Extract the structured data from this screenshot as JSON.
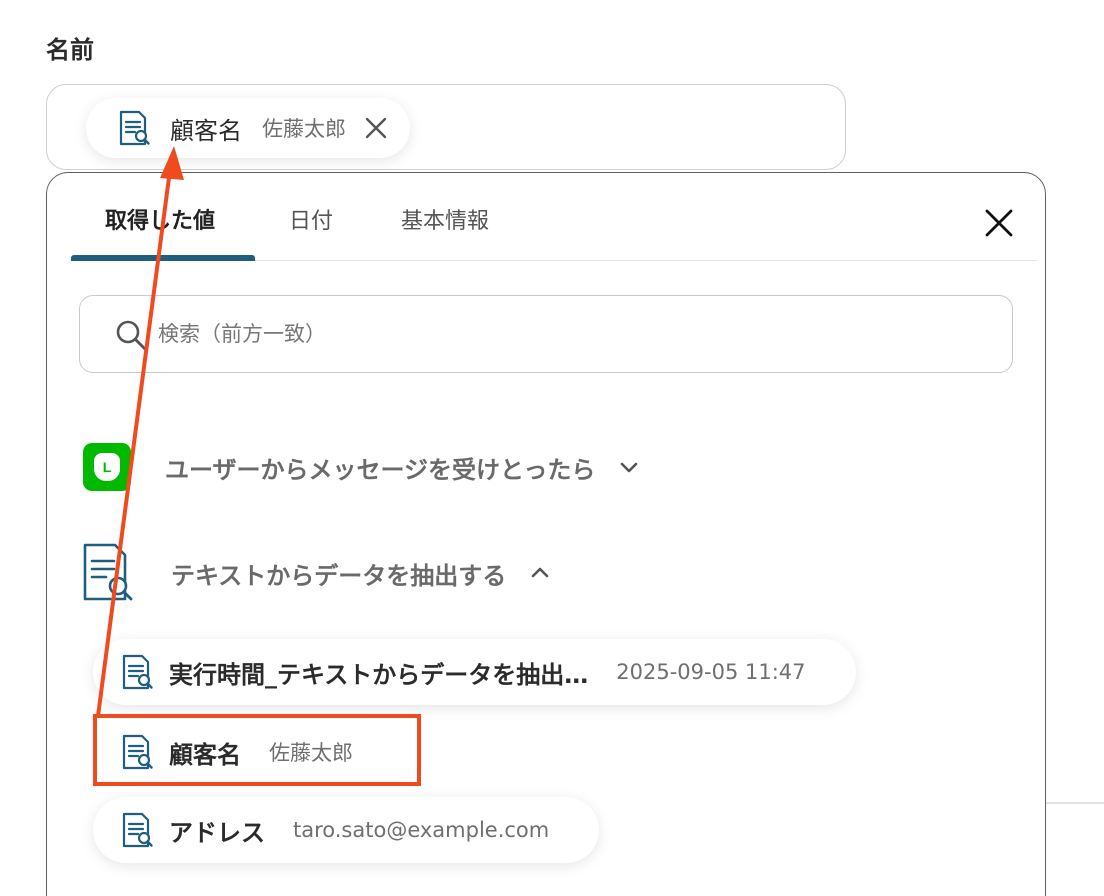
{
  "field": {
    "label": "名前",
    "chip": {
      "name": "顧客名",
      "value": "佐藤太郎"
    }
  },
  "tabs": [
    {
      "label": "取得した値",
      "active": true
    },
    {
      "label": "日付",
      "active": false
    },
    {
      "label": "基本情報",
      "active": false
    }
  ],
  "search": {
    "placeholder": "検索（前方一致）",
    "value": ""
  },
  "sections": [
    {
      "title": "ユーザーからメッセージを受けとったら",
      "icon": "line-app-icon",
      "expanded": false
    },
    {
      "title": "テキストからデータを抽出する",
      "icon": "document-search-icon",
      "expanded": true
    }
  ],
  "items": [
    {
      "name": "実行時間_テキストからデータを抽出…",
      "value": "2025-09-05 11:47"
    },
    {
      "name": "顧客名",
      "value": "佐藤太郎"
    },
    {
      "name": "アドレス",
      "value": "taro.sato@example.com"
    }
  ],
  "line_badge": "L",
  "colors": {
    "accent": "#1f5e7c",
    "highlight": "#f04b1f",
    "line_green": "#00b900",
    "doc_icon": "#1f5e7c"
  }
}
